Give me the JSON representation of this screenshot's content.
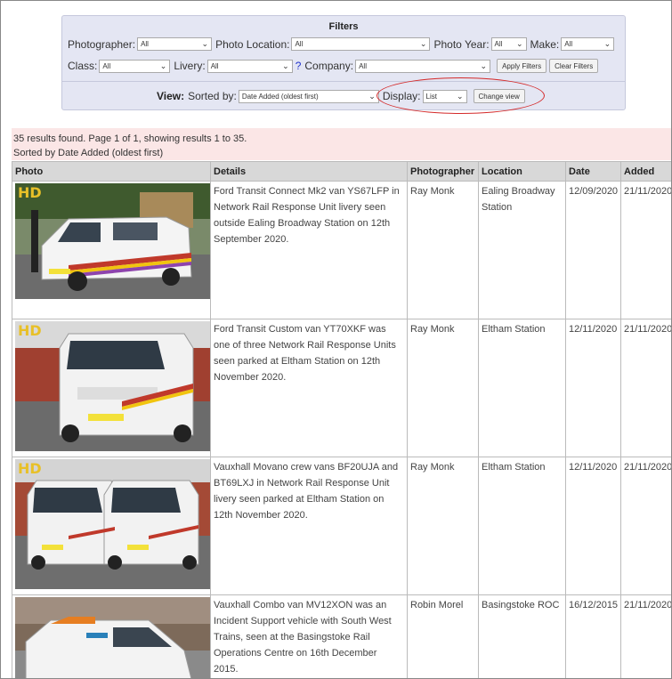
{
  "filters": {
    "title": "Filters",
    "photographer": {
      "label": "Photographer:",
      "value": "All"
    },
    "photo_location": {
      "label": "Photo Location:",
      "value": "All"
    },
    "photo_year": {
      "label": "Photo Year:",
      "value": "All"
    },
    "make": {
      "label": "Make:",
      "value": "All"
    },
    "class": {
      "label": "Class:",
      "value": "All"
    },
    "livery": {
      "label": "Livery:",
      "value": "All"
    },
    "help": "?",
    "company": {
      "label": "Company:",
      "value": "All"
    },
    "apply_label": "Apply Filters",
    "clear_label": "Clear Filters"
  },
  "view": {
    "label": "View:",
    "sorted_by_label": "Sorted by:",
    "sorted_by_value": "Date Added (oldest first)",
    "display_label": "Display:",
    "display_value": "List",
    "change_view_label": "Change view",
    "highlight_color": "#d42a2a"
  },
  "results_info": {
    "line1": "35 results found. Page 1 of 1, showing results 1 to 35.",
    "line2": "Sorted by Date Added (oldest first)"
  },
  "table": {
    "headers": [
      "Photo",
      "Details",
      "Photographer",
      "Location",
      "Date",
      "Added"
    ],
    "rows": [
      {
        "watermark": "HD",
        "details": "Ford Transit Connect Mk2 van YS67LFP in Network Rail Response Unit livery seen outside Ealing Broadway Station on 12th September 2020.",
        "photographer": "Ray Monk",
        "location": "Ealing Broadway Station",
        "date": "12/09/2020",
        "added": "21/11/2020"
      },
      {
        "watermark": "HD",
        "details": "Ford Transit Custom van YT70XKF was one of three Network Rail Response Units seen parked at Eltham Station on 12th November 2020.",
        "photographer": "Ray Monk",
        "location": "Eltham Station",
        "date": "12/11/2020",
        "added": "21/11/2020"
      },
      {
        "watermark": "HD",
        "details": "Vauxhall Movano crew vans BF20UJA and BT69LXJ in Network Rail Response Unit livery seen parked at Eltham Station on 12th November 2020.",
        "photographer": "Ray Monk",
        "location": "Eltham Station",
        "date": "12/11/2020",
        "added": "21/11/2020"
      },
      {
        "watermark": "",
        "details": "Vauxhall Combo van MV12XON was an Incident Support vehicle with South West Trains, seen at the Basingstoke Rail Operations Centre on 16th December 2015.",
        "photographer": "Robin Morel",
        "location": "Basingstoke ROC",
        "date": "16/12/2015",
        "added": "21/11/2020"
      }
    ]
  }
}
